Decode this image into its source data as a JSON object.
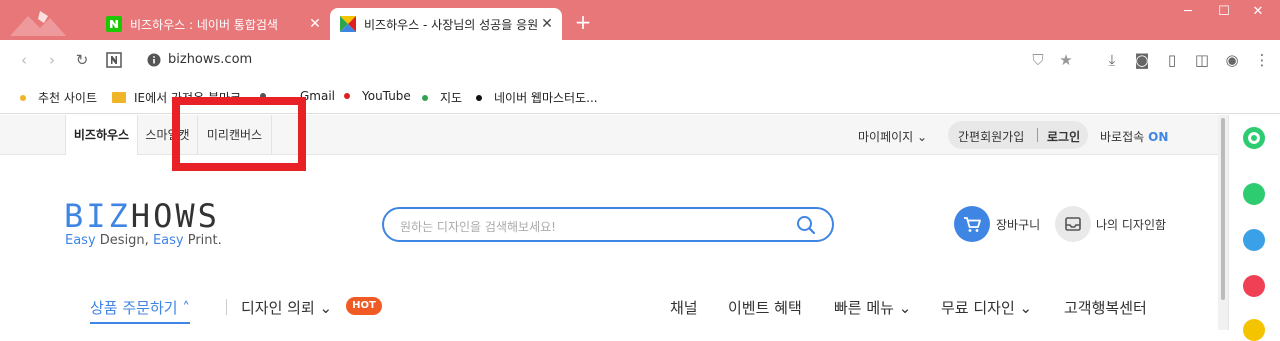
{
  "browser": {
    "tabs": [
      {
        "title": "비즈하우스 : 네이버 통합검색",
        "close": "✕"
      },
      {
        "title": "비즈하우스 - 사장님의 성공을 응원합니다",
        "close": "✕"
      }
    ],
    "new_tab": "+",
    "window_controls": [
      "─",
      "☐",
      "✕"
    ],
    "url": "bizhows.com",
    "bookmarks": [
      {
        "label": "추천 사이트",
        "color": "#f0b429"
      },
      {
        "label": "IE에서 가져온 북마크"
      },
      {
        "label": "Gmail",
        "color": "#555555"
      },
      {
        "label": "YouTube",
        "color": "#e02020"
      },
      {
        "label": "지도",
        "color": "#2ea44f"
      },
      {
        "label": "네이버 웹마스터도...",
        "color": "#111111"
      }
    ]
  },
  "site": {
    "tabs": [
      "비즈하우스",
      "스마일캣",
      "미리캔버스"
    ],
    "mypage": "마이페이지",
    "join": "간편회원가입",
    "login": "로그인",
    "quick_access": "바로접속",
    "quick_on": "ON",
    "logo": {
      "biz": "BIZ",
      "hows": "HOWS",
      "tag_easy1": "Easy",
      "tag_design": " Design, ",
      "tag_easy2": "Easy",
      "tag_print": " Print."
    },
    "search_placeholder": "원하는 디자인을 검색해보세요!",
    "cart": "장바구니",
    "my_design": "나의 디자인함",
    "nav": {
      "order": "상품 주문하기",
      "design_request": "디자인 의뢰",
      "hot": "HOT",
      "right": [
        "채널",
        "이벤트 혜택",
        "빠른 메뉴",
        "무료 디자인",
        "고객행복센터"
      ]
    }
  },
  "colors": {
    "titlebar": "#e8777a",
    "accent": "#3f85e3",
    "highlight": "#e82127",
    "hot": "#f05a24"
  }
}
